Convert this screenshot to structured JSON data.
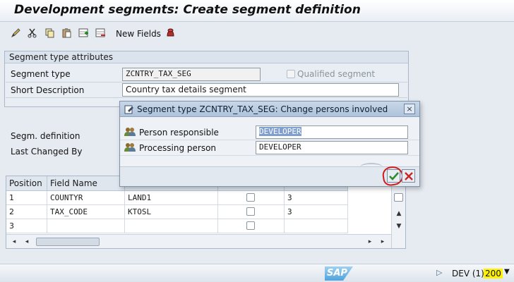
{
  "window": {
    "title": "Development segments: Create segment definition"
  },
  "toolbar": {
    "new_fields_label": "New Fields"
  },
  "segment_attributes": {
    "group_title": "Segment type attributes",
    "segment_type_label": "Segment type",
    "segment_type_value": "ZCNTRY_TAX_SEG",
    "qualified_label": "Qualified segment",
    "short_desc_label": "Short Description",
    "short_desc_value": "Country tax details segment"
  },
  "labels": {
    "segm_definition": "Segm. definition",
    "last_changed_by": "Last Changed By"
  },
  "table": {
    "headers": [
      "Position",
      "Field Name"
    ],
    "rows": [
      {
        "position": "1",
        "field_name": "COUNTYR",
        "data_element": "LAND1",
        "col5": "3"
      },
      {
        "position": "2",
        "field_name": "TAX_CODE",
        "data_element": "KTOSL",
        "col5": "3"
      },
      {
        "position": "3",
        "field_name": "",
        "data_element": "",
        "col5": ""
      }
    ]
  },
  "dialog": {
    "title": "Segment type ZCNTRY_TAX_SEG: Change persons involved",
    "close_label": "×",
    "person_responsible_label": "Person responsible",
    "person_responsible_value": "DEVELOPER",
    "processing_person_label": "Processing person",
    "processing_person_value": "DEVELOPER"
  },
  "status_bar": {
    "logo_text": "SAP",
    "system": "DEV (1)",
    "client": "200"
  },
  "colors": {
    "confirm_green": "#2e8b2e",
    "cancel_red": "#c62828",
    "highlight_yellow": "#fff200",
    "selection_blue": "#7f9fcf"
  }
}
